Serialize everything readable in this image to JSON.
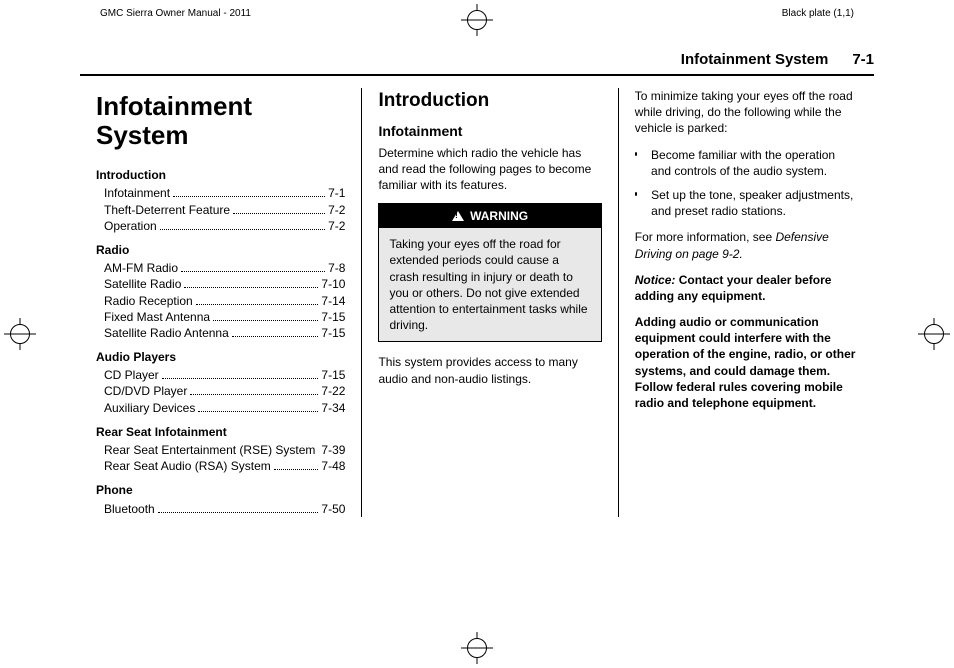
{
  "meta": {
    "doc_title": "GMC Sierra Owner Manual - 2011",
    "plate": "Black plate (1,1)"
  },
  "running_head": {
    "section": "Infotainment System",
    "page": "7-1"
  },
  "col1": {
    "title_line1": "Infotainment",
    "title_line2": "System",
    "groups": [
      {
        "title": "Introduction",
        "items": [
          {
            "label": "Infotainment",
            "page": "7-1"
          },
          {
            "label": "Theft-Deterrent Feature",
            "page": "7-2"
          },
          {
            "label": "Operation",
            "page": "7-2"
          }
        ]
      },
      {
        "title": "Radio",
        "items": [
          {
            "label": "AM-FM Radio",
            "page": "7-8"
          },
          {
            "label": "Satellite Radio",
            "page": "7-10"
          },
          {
            "label": "Radio Reception",
            "page": "7-14"
          },
          {
            "label": "Fixed Mast Antenna",
            "page": "7-15"
          },
          {
            "label": "Satellite Radio Antenna",
            "page": "7-15"
          }
        ]
      },
      {
        "title": "Audio Players",
        "items": [
          {
            "label": "CD Player",
            "page": "7-15"
          },
          {
            "label": "CD/DVD Player",
            "page": "7-22"
          },
          {
            "label": "Auxiliary Devices",
            "page": "7-34"
          }
        ]
      },
      {
        "title": "Rear Seat Infotainment",
        "items": [
          {
            "label": "Rear Seat Entertainment (RSE) System",
            "page": "7-39"
          },
          {
            "label": "Rear Seat Audio (RSA) System",
            "page": "7-48"
          }
        ]
      },
      {
        "title": "Phone",
        "items": [
          {
            "label": "Bluetooth",
            "page": "7-50"
          }
        ]
      }
    ]
  },
  "col2": {
    "heading": "Introduction",
    "subheading": "Infotainment",
    "intro_para": "Determine which radio the vehicle has and read the following pages to become familiar with its features.",
    "warning_label": "WARNING",
    "warning_body": "Taking your eyes off the road for extended periods could cause a crash resulting in injury or death to you or others. Do not give extended attention to entertainment tasks while driving.",
    "after_warning": "This system provides access to many audio and non-audio listings."
  },
  "col3": {
    "lead": "To minimize taking your eyes off the road while driving, do the following while the vehicle is parked:",
    "bullets": [
      "Become familiar with the operation and controls of the audio system.",
      "Set up the tone, speaker adjustments, and preset radio stations."
    ],
    "more_info_pre": "For more information, see ",
    "more_info_ref": "Defensive Driving on page 9-2.",
    "notice_label": "Notice:",
    "notice_body": "Contact your dealer before adding any equipment.",
    "bold_para": "Adding audio or communication equipment could interfere with the operation of the engine, radio, or other systems, and could damage them. Follow federal rules covering mobile radio and telephone equipment."
  }
}
